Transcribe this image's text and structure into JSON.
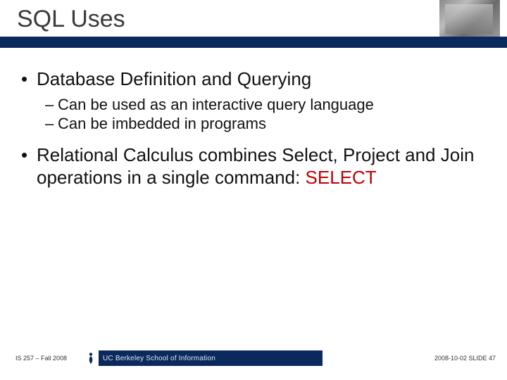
{
  "title": "SQL Uses",
  "bullets": {
    "b1a": "Database Definition and Querying",
    "b2a": "Can be used as an interactive query language",
    "b2b": "Can be imbedded in programs",
    "b1b_prefix": "Relational Calculus combines Select, Project and Join operations in a single command: ",
    "b1b_keyword": "SELECT"
  },
  "footer": {
    "left": "IS 257 – Fall 2008",
    "school": "UC Berkeley School of Information",
    "right": "2008-10-02  SLIDE 47"
  }
}
